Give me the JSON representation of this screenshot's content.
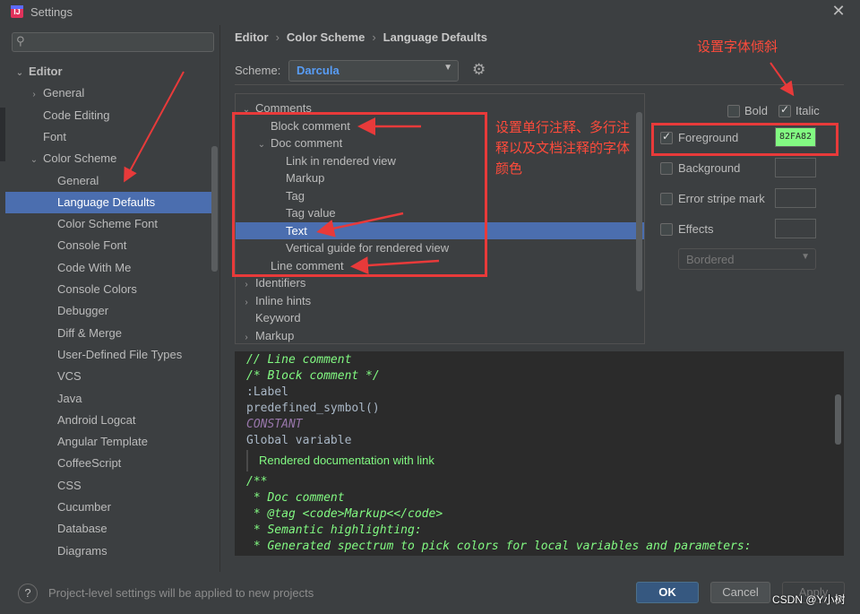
{
  "window": {
    "title": "Settings",
    "close_glyph": "✕"
  },
  "sidebar": {
    "search_placeholder": "",
    "items": [
      {
        "label": "Editor",
        "level": 0,
        "expanded": true,
        "bold": true
      },
      {
        "label": "General",
        "level": 1,
        "expanded": false
      },
      {
        "label": "Code Editing",
        "level": 1
      },
      {
        "label": "Font",
        "level": 1
      },
      {
        "label": "Color Scheme",
        "level": 1,
        "expanded": true
      },
      {
        "label": "General",
        "level": 2
      },
      {
        "label": "Language Defaults",
        "level": 2,
        "selected": true
      },
      {
        "label": "Color Scheme Font",
        "level": 2
      },
      {
        "label": "Console Font",
        "level": 2
      },
      {
        "label": "Code With Me",
        "level": 2
      },
      {
        "label": "Console Colors",
        "level": 2
      },
      {
        "label": "Debugger",
        "level": 2
      },
      {
        "label": "Diff & Merge",
        "level": 2
      },
      {
        "label": "User-Defined File Types",
        "level": 2
      },
      {
        "label": "VCS",
        "level": 2
      },
      {
        "label": "Java",
        "level": 2
      },
      {
        "label": "Android Logcat",
        "level": 2
      },
      {
        "label": "Angular Template",
        "level": 2
      },
      {
        "label": "CoffeeScript",
        "level": 2
      },
      {
        "label": "CSS",
        "level": 2
      },
      {
        "label": "Cucumber",
        "level": 2
      },
      {
        "label": "Database",
        "level": 2
      },
      {
        "label": "Diagrams",
        "level": 2
      }
    ]
  },
  "breadcrumb": [
    "Editor",
    "Color Scheme",
    "Language Defaults"
  ],
  "scheme": {
    "label": "Scheme:",
    "value": "Darcula"
  },
  "element_tree": [
    {
      "label": "Comments",
      "indent": 0,
      "chevron": "down"
    },
    {
      "label": "Block comment",
      "indent": 1
    },
    {
      "label": "Doc comment",
      "indent": 1,
      "chevron": "down"
    },
    {
      "label": "Link in rendered view",
      "indent": 2
    },
    {
      "label": "Markup",
      "indent": 2
    },
    {
      "label": "Tag",
      "indent": 2
    },
    {
      "label": "Tag value",
      "indent": 2
    },
    {
      "label": "Text",
      "indent": 2,
      "selected": true
    },
    {
      "label": "Vertical guide for rendered view",
      "indent": 2
    },
    {
      "label": "Line comment",
      "indent": 1
    },
    {
      "label": "Identifiers",
      "indent": 0,
      "chevron": "right"
    },
    {
      "label": "Inline hints",
      "indent": 0,
      "chevron": "right"
    },
    {
      "label": "Keyword",
      "indent": 0
    },
    {
      "label": "Markup",
      "indent": 0,
      "chevron": "right"
    }
  ],
  "attributes": {
    "bold": {
      "label": "Bold",
      "checked": false
    },
    "italic": {
      "label": "Italic",
      "checked": true
    },
    "foreground": {
      "label": "Foreground",
      "checked": true,
      "value": "82FA82",
      "color": "#82fa82"
    },
    "background": {
      "label": "Background",
      "checked": false
    },
    "error_stripe": {
      "label": "Error stripe mark",
      "checked": false
    },
    "effects": {
      "label": "Effects",
      "checked": false,
      "select_value": "Bordered"
    }
  },
  "preview": {
    "lines": [
      {
        "text": "// Line comment",
        "style": "comment"
      },
      {
        "text": "/* Block comment */",
        "style": "comment"
      },
      {
        "text": ":Label",
        "style": "plain"
      },
      {
        "text": "predefined_symbol()",
        "style": "plain"
      },
      {
        "text": "CONSTANT",
        "style": "const"
      },
      {
        "text": "Global variable",
        "style": "plain"
      }
    ],
    "rendered_doc": "Rendered documentation with link",
    "doc_lines": [
      "/**",
      " * Doc comment",
      " * @tag <code>Markup<</code>",
      " * Semantic highlighting:",
      " * Generated spectrum to pick colors for local variables and parameters:"
    ]
  },
  "footer": {
    "help": "?",
    "note": "Project-level settings will be applied to new projects",
    "ok": "OK",
    "cancel": "Cancel",
    "apply": "Apply",
    "watermark": "CSDN @Y小树"
  },
  "annotations": {
    "italic_note": "设置字体倾斜",
    "color_note": "设置单行注释、多行注释以及文档注释的字体颜色",
    "color": "#e83a3a"
  }
}
